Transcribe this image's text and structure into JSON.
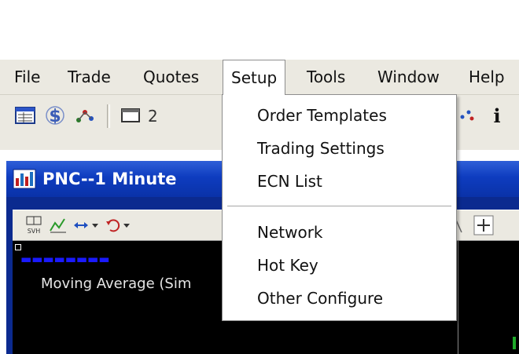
{
  "menu": {
    "items": [
      "File",
      "Trade",
      "Quotes",
      "Setup",
      "Tools",
      "Window",
      "Help"
    ],
    "active": "Setup"
  },
  "setup_menu": {
    "group1": [
      "Order Templates",
      "Trading Settings",
      "ECN List"
    ],
    "group2": [
      "Network",
      "Hot Key",
      "Other Configure"
    ]
  },
  "chart_window": {
    "title": "PNC--1 Minute",
    "indicator_label": "Moving Average (Sim",
    "colors": {
      "title_bar": "#0e3cbf",
      "plot_background": "#000000"
    }
  },
  "icons": {
    "toolbar": [
      "grid-window-icon",
      "dollar-icon",
      "network-icon",
      "window-icon",
      "info-icon"
    ],
    "chart_toolbar": [
      "svh-icon",
      "line-chart-icon",
      "arrows-horizontal-icon",
      "undo-icon",
      "plus-icon"
    ]
  }
}
